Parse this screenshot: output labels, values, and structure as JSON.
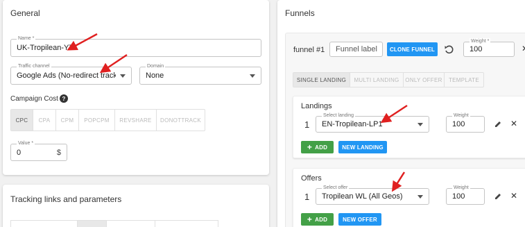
{
  "general": {
    "title": "General",
    "name": {
      "label": "Name *",
      "value": "UK-Tropilean-YT"
    },
    "traffic_channel": {
      "label": "Traffic channel",
      "value": "Google Ads (No-redirect track..."
    },
    "domain": {
      "label": "Domain",
      "value": "None"
    },
    "campaign_cost": {
      "label": "Campaign Cost",
      "help_icon": "help-circle-icon"
    },
    "cost_models": [
      "CPC",
      "CPA",
      "CPM",
      "POPCPM",
      "REVSHARE",
      "DONOTTRACK"
    ],
    "cost_active": "CPC",
    "value_field": {
      "label": "Value *",
      "value": "0",
      "suffix": "$"
    }
  },
  "tracking": {
    "title": "Tracking links and parameters"
  },
  "funnels": {
    "title": "Funnels",
    "funnel_name": "funnel #1",
    "funnel_label_placeholder": "Funnel label",
    "clone_label": "CLONE FUNNEL",
    "weight": {
      "label": "Weight *",
      "value": "100"
    },
    "tabs": [
      "SINGLE LANDING",
      "MULTI LANDING",
      "ONLY OFFER",
      "TEMPLATE"
    ],
    "tab_active": "SINGLE LANDING",
    "landings": {
      "title": "Landings",
      "index": "1",
      "select": {
        "label": "Select landing",
        "value": "EN-Tropilean-LP1"
      },
      "weight": {
        "label": "Weight",
        "value": "100"
      },
      "add_label": "ADD",
      "new_label": "NEW LANDING"
    },
    "offers": {
      "title": "Offers",
      "index": "1",
      "select": {
        "label": "Select offer",
        "value": "Tropilean WL (All Geos)"
      },
      "weight": {
        "label": "Weight",
        "value": "100"
      },
      "add_label": "ADD",
      "new_label": "NEW OFFER"
    }
  },
  "colors": {
    "accent_green": "#43a047",
    "accent_blue": "#2196f3",
    "annotation_red": "#e02020"
  }
}
